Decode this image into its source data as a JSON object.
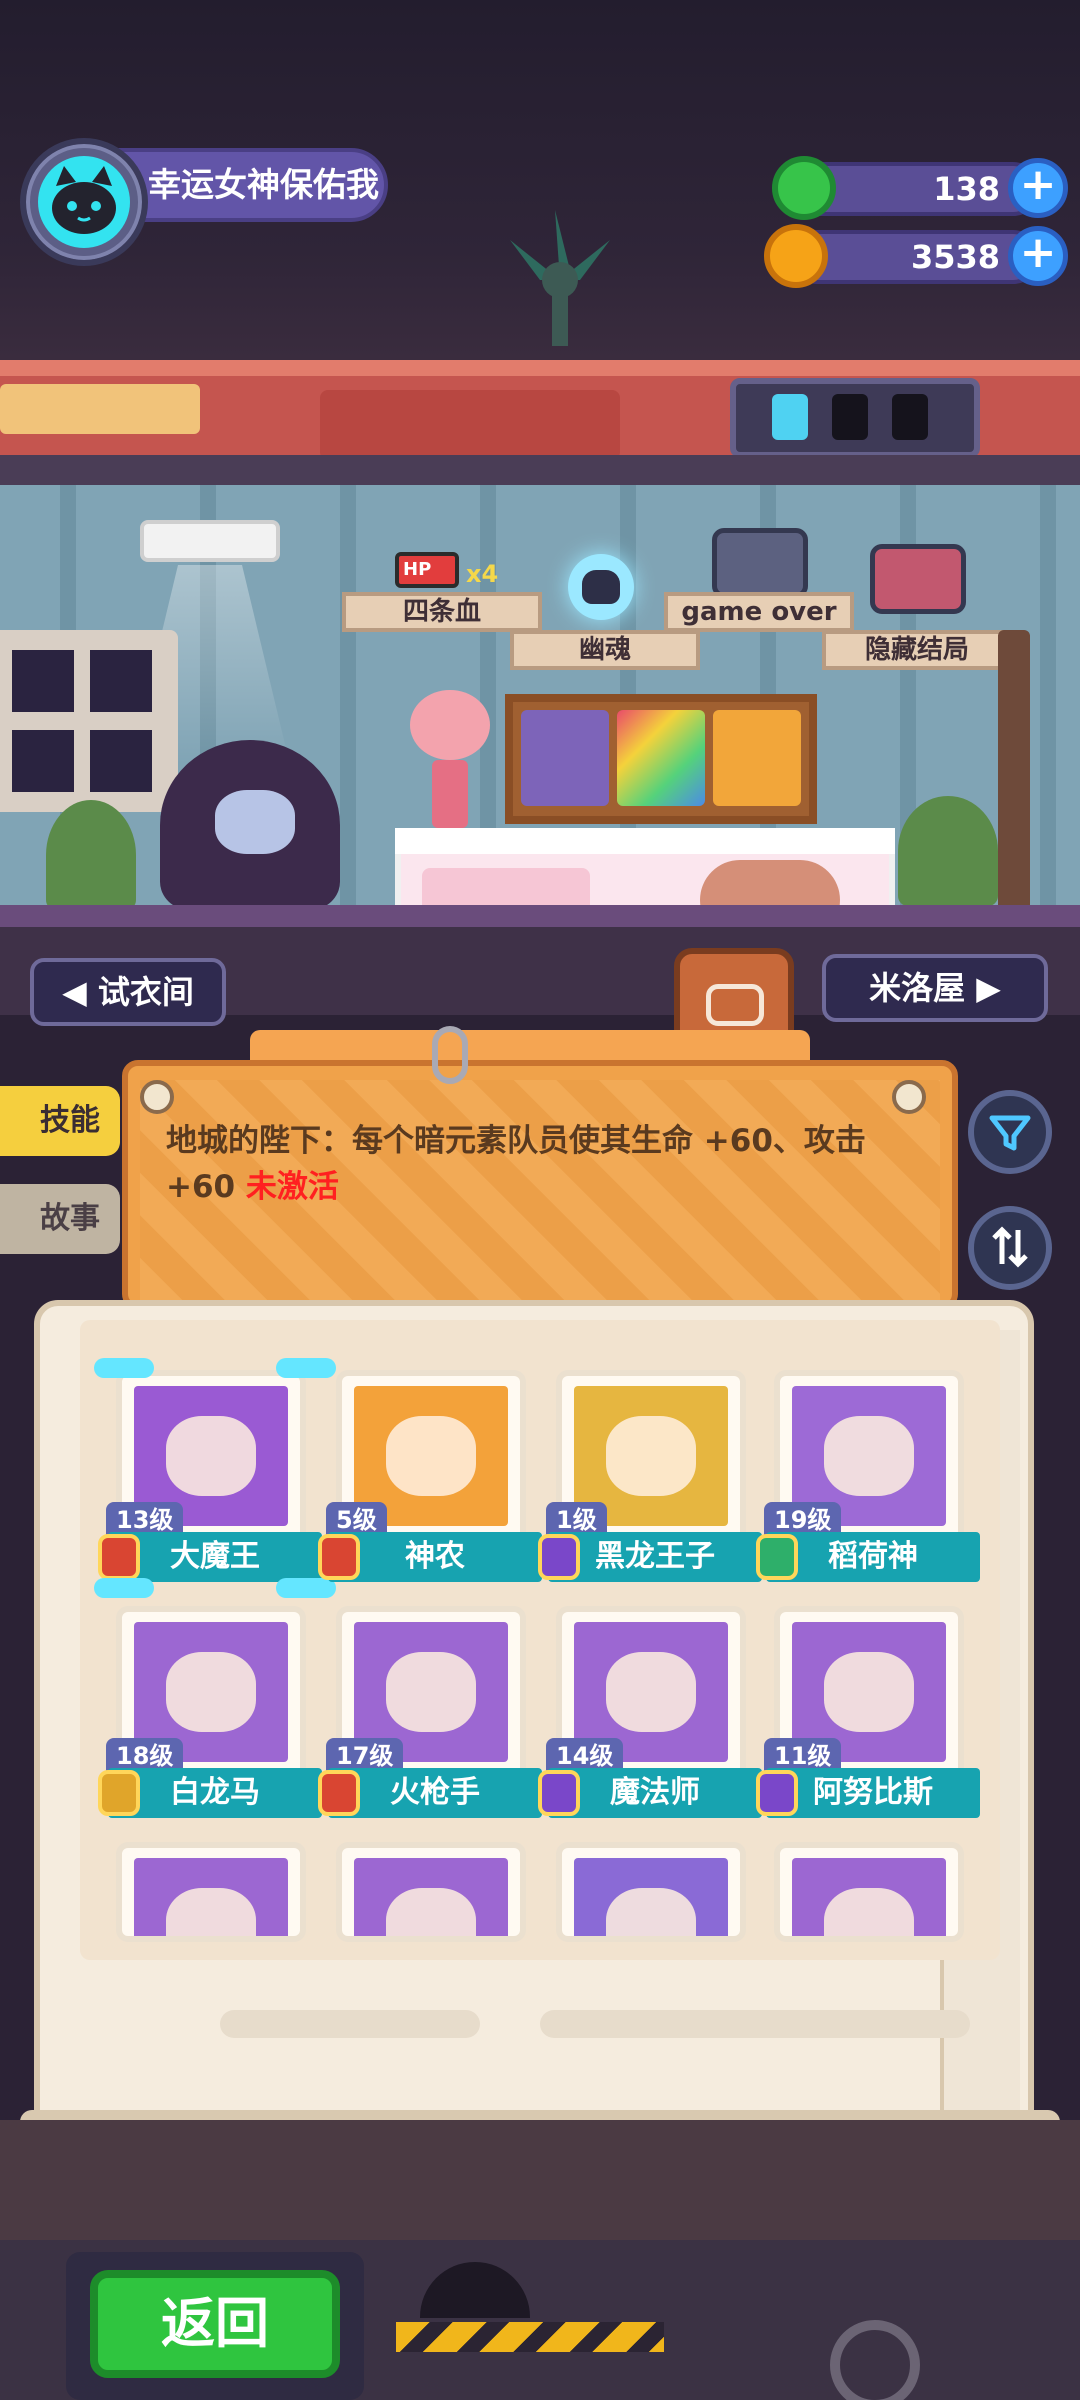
{
  "player": {
    "name": "幸运女神保佑我",
    "avatar_icon": "cat-avatar-icon"
  },
  "currencies": [
    {
      "name": "gem",
      "icon": "green-coin-icon",
      "amount": "138",
      "color": "#37c44a"
    },
    {
      "name": "gold",
      "icon": "orange-planet-icon",
      "amount": "3538",
      "color": "#f6a317"
    }
  ],
  "room": {
    "endings": [
      {
        "title": "四条血",
        "badge": "x4",
        "icon": "hp-battery-icon"
      },
      {
        "title": "幽魂",
        "icon": "ghost-skull-icon"
      },
      {
        "title": "game over",
        "icon": "tv-tombstone-icon"
      },
      {
        "title": "隐藏结局",
        "icon": "tv-portrait-icon"
      }
    ],
    "hp_label": "HP",
    "nav_left": "试衣间",
    "nav_right": "米洛屋"
  },
  "panel": {
    "tabs": [
      {
        "label": "技能",
        "active": true
      },
      {
        "label": "故事",
        "active": false
      }
    ],
    "skill_text": "地城的陛下：每个暗元素队员使其生命 +60、攻击 +60",
    "skill_status": "未激活",
    "status_color": "#ff2020"
  },
  "characters": [
    {
      "level": "13级",
      "name": "大魔王",
      "element": "fire",
      "elem_color": "#d94532",
      "art": "#9a5ad3",
      "selected": true
    },
    {
      "level": "5级",
      "name": "神农",
      "element": "fire",
      "elem_color": "#d94532",
      "art": "#f3a23a",
      "selected": false
    },
    {
      "level": "1级",
      "name": "黑龙王子",
      "element": "dark",
      "elem_color": "#7a47c9",
      "art": "#e6b640",
      "selected": false
    },
    {
      "level": "19级",
      "name": "稻荷神",
      "element": "wind",
      "elem_color": "#2eaf6a",
      "art": "#9d6ad6",
      "selected": false
    },
    {
      "level": "18级",
      "name": "白龙马",
      "element": "light",
      "elem_color": "#e0a52a",
      "art": "#9c67d2",
      "selected": false
    },
    {
      "level": "17级",
      "name": "火枪手",
      "element": "fire",
      "elem_color": "#d94532",
      "art": "#9c67d2",
      "selected": false
    },
    {
      "level": "14级",
      "name": "魔法师",
      "element": "dark",
      "elem_color": "#7a47c9",
      "art": "#9c67d2",
      "selected": false
    },
    {
      "level": "11级",
      "name": "阿努比斯",
      "element": "dark",
      "elem_color": "#7a47c9",
      "art": "#9c67d2",
      "selected": false
    },
    {
      "level": "",
      "name": "",
      "element": "",
      "elem_color": "",
      "art": "#9c67d2",
      "selected": false
    },
    {
      "level": "",
      "name": "",
      "element": "",
      "elem_color": "",
      "art": "#9c67d2",
      "selected": false
    },
    {
      "level": "",
      "name": "",
      "element": "",
      "elem_color": "",
      "art": "#8a6ad6",
      "selected": false
    },
    {
      "level": "",
      "name": "",
      "element": "",
      "elem_color": "",
      "art": "#9c67d2",
      "selected": false
    }
  ],
  "footer": {
    "back_label": "返回"
  }
}
